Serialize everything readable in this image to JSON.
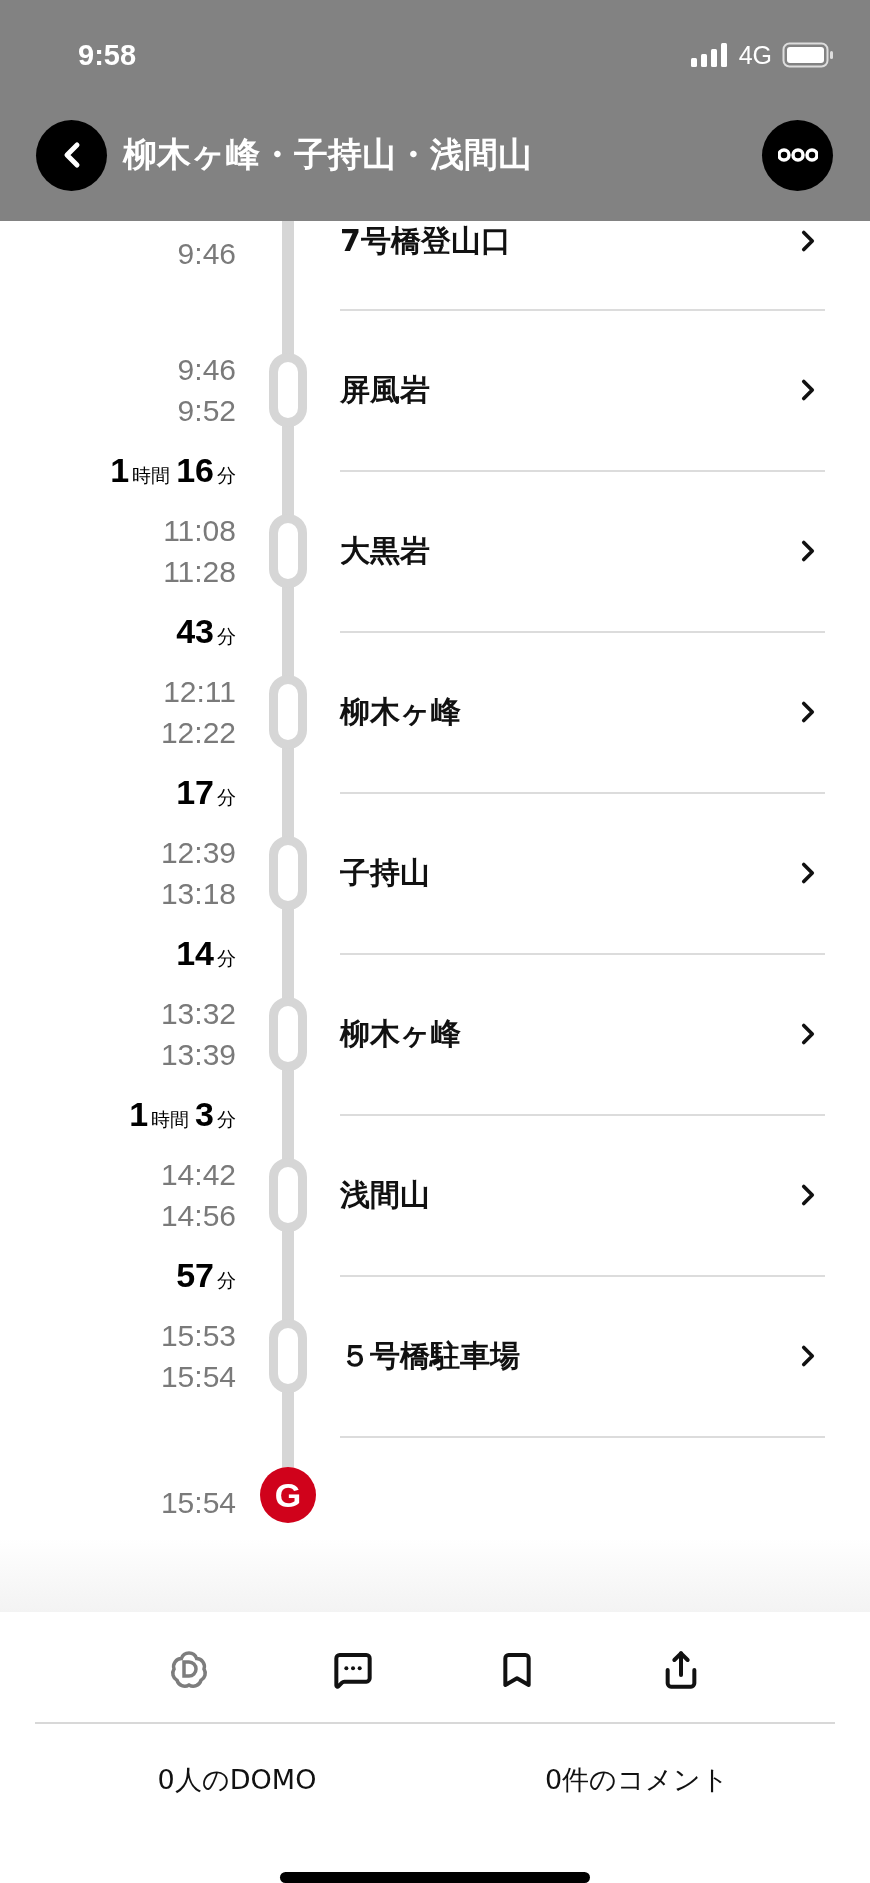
{
  "status_bar": {
    "time": "9:58",
    "network": "4G"
  },
  "header": {
    "title": "柳木ヶ峰・子持山・浅間山"
  },
  "first_stop": {
    "name": "7号橋登山口",
    "times": [
      "9:46"
    ]
  },
  "stops": [
    {
      "name": "屏風岩",
      "times": [
        "9:46",
        "9:52"
      ],
      "duration": [
        {
          "value": "1",
          "unit": "時間"
        },
        {
          "value": "16",
          "unit": "分"
        }
      ]
    },
    {
      "name": "大黒岩",
      "times": [
        "11:08",
        "11:28"
      ],
      "duration": [
        {
          "value": "43",
          "unit": "分"
        }
      ]
    },
    {
      "name": "柳木ヶ峰",
      "times": [
        "12:11",
        "12:22"
      ],
      "duration": [
        {
          "value": "17",
          "unit": "分"
        }
      ]
    },
    {
      "name": "子持山",
      "times": [
        "12:39",
        "13:18"
      ],
      "duration": [
        {
          "value": "14",
          "unit": "分"
        }
      ]
    },
    {
      "name": "柳木ヶ峰",
      "times": [
        "13:32",
        "13:39"
      ],
      "duration": [
        {
          "value": "1",
          "unit": "時間"
        },
        {
          "value": "3",
          "unit": "分"
        }
      ]
    },
    {
      "name": "浅間山",
      "times": [
        "14:42",
        "14:56"
      ],
      "duration": [
        {
          "value": "57",
          "unit": "分"
        }
      ]
    },
    {
      "name": "５号橋駐車場",
      "times": [
        "15:53",
        "15:54"
      ]
    }
  ],
  "goal": {
    "badge": "G",
    "time": "15:54"
  },
  "footer": {
    "domo_count": "0人のDOMO",
    "comment_count": "0件のコメント"
  }
}
